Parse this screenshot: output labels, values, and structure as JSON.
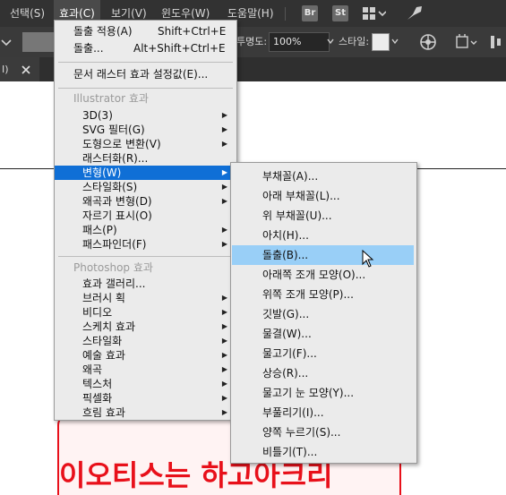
{
  "menubar": {
    "items": [
      "선택(S)",
      "효과(C)",
      "보기(V)",
      "윈도우(W)",
      "도움말(H)"
    ],
    "app_icons": [
      "Br",
      "St"
    ]
  },
  "controlbar": {
    "opacity_label": "투명도:",
    "opacity_value": "100%",
    "style_label": "스타일:"
  },
  "tabbar": {
    "tab_text": "I)"
  },
  "effect_menu": {
    "apply_label": "돌출 적용(A)",
    "apply_shortcut": "Shift+Ctrl+E",
    "last_label": "돌출...",
    "last_shortcut": "Alt+Shift+Ctrl+E",
    "raster_settings": "문서 래스터 효과 설정값(E)...",
    "illustrator_header": "Illustrator 효과",
    "illustrator_items": [
      {
        "label": "3D(3)",
        "sub": true
      },
      {
        "label": "SVG 필터(G)",
        "sub": true
      },
      {
        "label": "도형으로 변환(V)",
        "sub": true
      },
      {
        "label": "래스터화(R)...",
        "sub": false
      },
      {
        "label": "변형(W)",
        "sub": true
      },
      {
        "label": "스타일화(S)",
        "sub": true
      },
      {
        "label": "왜곡과 변형(D)",
        "sub": true
      },
      {
        "label": "자르기 표시(O)",
        "sub": false
      },
      {
        "label": "패스(P)",
        "sub": true
      },
      {
        "label": "패스파인더(F)",
        "sub": true
      }
    ],
    "photoshop_header": "Photoshop 효과",
    "photoshop_items": [
      {
        "label": "효과 갤러리...",
        "sub": false
      },
      {
        "label": "브러시 획",
        "sub": true
      },
      {
        "label": "비디오",
        "sub": true
      },
      {
        "label": "스케치 효과",
        "sub": true
      },
      {
        "label": "스타일화",
        "sub": true
      },
      {
        "label": "예술 효과",
        "sub": true
      },
      {
        "label": "왜곡",
        "sub": true
      },
      {
        "label": "텍스처",
        "sub": true
      },
      {
        "label": "픽셀화",
        "sub": true
      },
      {
        "label": "흐림 효과",
        "sub": true
      }
    ]
  },
  "warp_submenu": {
    "items": [
      "부채꼴(A)...",
      "아래 부채꼴(L)...",
      "위 부채꼴(U)...",
      "아치(H)...",
      "돌출(B)...",
      "아래쪽 조개 모양(O)...",
      "위쪽 조개 모양(P)...",
      "깃발(G)...",
      "물결(W)...",
      "물고기(F)...",
      "상승(R)...",
      "물고기 눈 모양(Y)...",
      "부풀리기(I)...",
      "양쪽 누르기(S)...",
      "비틀기(T)..."
    ],
    "highlighted": "돌출(B)..."
  },
  "canvas": {
    "art_text": "이오티스는 하고아크리"
  },
  "colors": {
    "menubar": "#323232",
    "menu_bg": "#ebebeb",
    "highlight": "#0f6fd6",
    "submenu_highlight": "#99cff7",
    "art_red": "#e8101a"
  }
}
